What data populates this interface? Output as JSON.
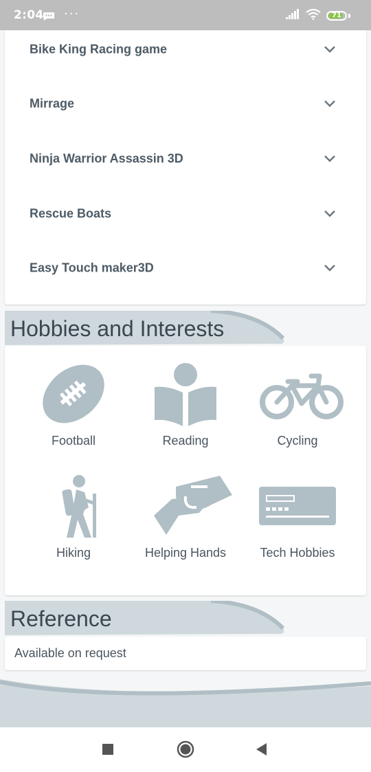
{
  "status_bar": {
    "time": "2:04",
    "dots": "···",
    "battery_level": "71",
    "battery_color": "#8bc34a"
  },
  "games": {
    "items": [
      {
        "label": "Bike King Racing game"
      },
      {
        "label": "Mirrage"
      },
      {
        "label": "Ninja Warrior Assassin 3D"
      },
      {
        "label": "Rescue Boats"
      },
      {
        "label": "Easy Touch maker3D"
      }
    ]
  },
  "hobbies_section": {
    "title": "Hobbies and Interests",
    "items": [
      {
        "label": "Football",
        "icon": "football-icon"
      },
      {
        "label": "Reading",
        "icon": "reading-icon"
      },
      {
        "label": "Cycling",
        "icon": "bicycle-icon"
      },
      {
        "label": "Hiking",
        "icon": "hiking-icon"
      },
      {
        "label": "Helping Hands",
        "icon": "helping-hands-icon"
      },
      {
        "label": "Tech Hobbies",
        "icon": "tech-card-icon"
      }
    ]
  },
  "reference_section": {
    "title": "Reference",
    "text": "Available on request"
  },
  "theme": {
    "icon_color": "#b0bec5",
    "header_band": "#cfd8dc",
    "text_color": "#4a5560"
  }
}
